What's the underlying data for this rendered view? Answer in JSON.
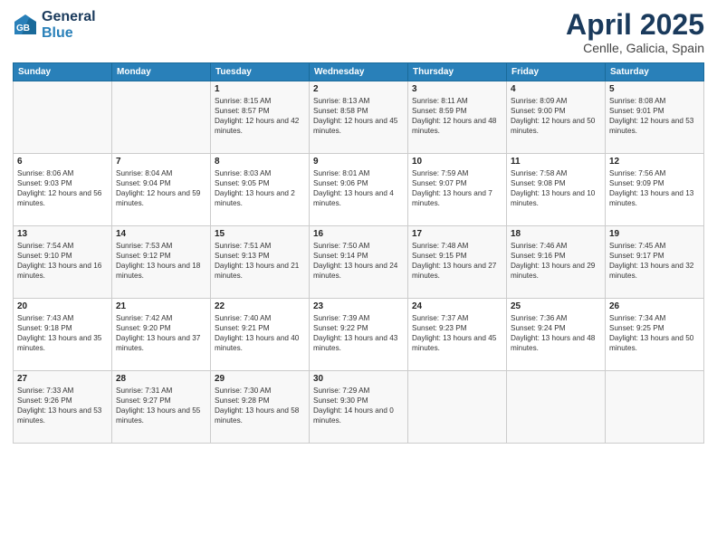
{
  "header": {
    "logo_line1": "General",
    "logo_line2": "Blue",
    "title": "April 2025",
    "location": "Cenlle, Galicia, Spain"
  },
  "weekdays": [
    "Sunday",
    "Monday",
    "Tuesday",
    "Wednesday",
    "Thursday",
    "Friday",
    "Saturday"
  ],
  "weeks": [
    [
      {
        "day": "",
        "info": ""
      },
      {
        "day": "",
        "info": ""
      },
      {
        "day": "1",
        "info": "Sunrise: 8:15 AM\nSunset: 8:57 PM\nDaylight: 12 hours and 42 minutes."
      },
      {
        "day": "2",
        "info": "Sunrise: 8:13 AM\nSunset: 8:58 PM\nDaylight: 12 hours and 45 minutes."
      },
      {
        "day": "3",
        "info": "Sunrise: 8:11 AM\nSunset: 8:59 PM\nDaylight: 12 hours and 48 minutes."
      },
      {
        "day": "4",
        "info": "Sunrise: 8:09 AM\nSunset: 9:00 PM\nDaylight: 12 hours and 50 minutes."
      },
      {
        "day": "5",
        "info": "Sunrise: 8:08 AM\nSunset: 9:01 PM\nDaylight: 12 hours and 53 minutes."
      }
    ],
    [
      {
        "day": "6",
        "info": "Sunrise: 8:06 AM\nSunset: 9:03 PM\nDaylight: 12 hours and 56 minutes."
      },
      {
        "day": "7",
        "info": "Sunrise: 8:04 AM\nSunset: 9:04 PM\nDaylight: 12 hours and 59 minutes."
      },
      {
        "day": "8",
        "info": "Sunrise: 8:03 AM\nSunset: 9:05 PM\nDaylight: 13 hours and 2 minutes."
      },
      {
        "day": "9",
        "info": "Sunrise: 8:01 AM\nSunset: 9:06 PM\nDaylight: 13 hours and 4 minutes."
      },
      {
        "day": "10",
        "info": "Sunrise: 7:59 AM\nSunset: 9:07 PM\nDaylight: 13 hours and 7 minutes."
      },
      {
        "day": "11",
        "info": "Sunrise: 7:58 AM\nSunset: 9:08 PM\nDaylight: 13 hours and 10 minutes."
      },
      {
        "day": "12",
        "info": "Sunrise: 7:56 AM\nSunset: 9:09 PM\nDaylight: 13 hours and 13 minutes."
      }
    ],
    [
      {
        "day": "13",
        "info": "Sunrise: 7:54 AM\nSunset: 9:10 PM\nDaylight: 13 hours and 16 minutes."
      },
      {
        "day": "14",
        "info": "Sunrise: 7:53 AM\nSunset: 9:12 PM\nDaylight: 13 hours and 18 minutes."
      },
      {
        "day": "15",
        "info": "Sunrise: 7:51 AM\nSunset: 9:13 PM\nDaylight: 13 hours and 21 minutes."
      },
      {
        "day": "16",
        "info": "Sunrise: 7:50 AM\nSunset: 9:14 PM\nDaylight: 13 hours and 24 minutes."
      },
      {
        "day": "17",
        "info": "Sunrise: 7:48 AM\nSunset: 9:15 PM\nDaylight: 13 hours and 27 minutes."
      },
      {
        "day": "18",
        "info": "Sunrise: 7:46 AM\nSunset: 9:16 PM\nDaylight: 13 hours and 29 minutes."
      },
      {
        "day": "19",
        "info": "Sunrise: 7:45 AM\nSunset: 9:17 PM\nDaylight: 13 hours and 32 minutes."
      }
    ],
    [
      {
        "day": "20",
        "info": "Sunrise: 7:43 AM\nSunset: 9:18 PM\nDaylight: 13 hours and 35 minutes."
      },
      {
        "day": "21",
        "info": "Sunrise: 7:42 AM\nSunset: 9:20 PM\nDaylight: 13 hours and 37 minutes."
      },
      {
        "day": "22",
        "info": "Sunrise: 7:40 AM\nSunset: 9:21 PM\nDaylight: 13 hours and 40 minutes."
      },
      {
        "day": "23",
        "info": "Sunrise: 7:39 AM\nSunset: 9:22 PM\nDaylight: 13 hours and 43 minutes."
      },
      {
        "day": "24",
        "info": "Sunrise: 7:37 AM\nSunset: 9:23 PM\nDaylight: 13 hours and 45 minutes."
      },
      {
        "day": "25",
        "info": "Sunrise: 7:36 AM\nSunset: 9:24 PM\nDaylight: 13 hours and 48 minutes."
      },
      {
        "day": "26",
        "info": "Sunrise: 7:34 AM\nSunset: 9:25 PM\nDaylight: 13 hours and 50 minutes."
      }
    ],
    [
      {
        "day": "27",
        "info": "Sunrise: 7:33 AM\nSunset: 9:26 PM\nDaylight: 13 hours and 53 minutes."
      },
      {
        "day": "28",
        "info": "Sunrise: 7:31 AM\nSunset: 9:27 PM\nDaylight: 13 hours and 55 minutes."
      },
      {
        "day": "29",
        "info": "Sunrise: 7:30 AM\nSunset: 9:28 PM\nDaylight: 13 hours and 58 minutes."
      },
      {
        "day": "30",
        "info": "Sunrise: 7:29 AM\nSunset: 9:30 PM\nDaylight: 14 hours and 0 minutes."
      },
      {
        "day": "",
        "info": ""
      },
      {
        "day": "",
        "info": ""
      },
      {
        "day": "",
        "info": ""
      }
    ]
  ]
}
